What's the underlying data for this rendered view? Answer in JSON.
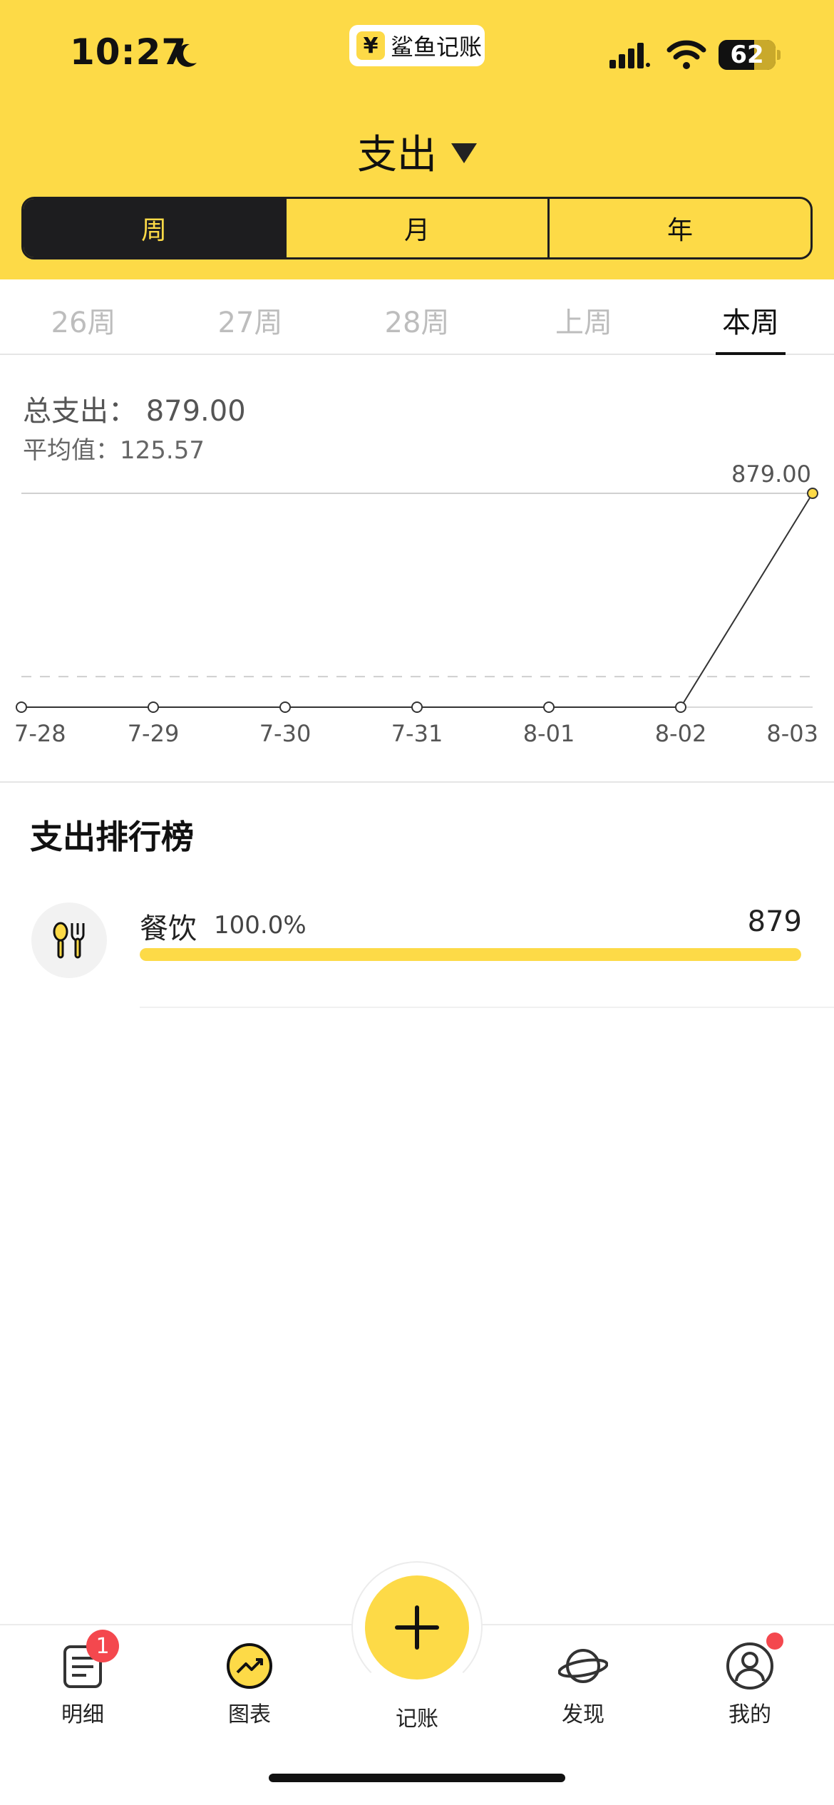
{
  "status_bar": {
    "time": "10:27",
    "app_name": "鲨鱼记账",
    "app_badge_glyph": "¥",
    "battery": "62"
  },
  "header": {
    "title": "支出",
    "segments": [
      {
        "label": "周",
        "active": true
      },
      {
        "label": "月",
        "active": false
      },
      {
        "label": "年",
        "active": false
      }
    ]
  },
  "week_tabs": [
    {
      "label": "26周",
      "active": false
    },
    {
      "label": "27周",
      "active": false
    },
    {
      "label": "28周",
      "active": false
    },
    {
      "label": "上周",
      "active": false
    },
    {
      "label": "本周",
      "active": true
    }
  ],
  "summary": {
    "total_text": "总支出：  879.00",
    "avg_text": "平均值：125.57"
  },
  "chart_data": {
    "type": "line",
    "x": [
      "7-28",
      "7-29",
      "7-30",
      "7-31",
      "8-01",
      "8-02",
      "8-03"
    ],
    "series": [
      {
        "values": [
          0,
          0,
          0,
          0,
          0,
          0,
          879
        ]
      }
    ],
    "max_label": "879.00",
    "average": 125.57,
    "ylim": [
      0,
      879
    ],
    "grid": false,
    "colors": {
      "line": "#333333",
      "highlight_point": "#FDDA47",
      "average_line": "#cfcfcf"
    }
  },
  "ranking": {
    "title": "支出排行榜",
    "items": [
      {
        "name": "餐饮",
        "percent": "100.0%",
        "amount": "879",
        "fraction": 1.0,
        "icon": "utensils-icon"
      }
    ]
  },
  "tabbar": {
    "items": [
      {
        "label": "明细",
        "icon": "list-icon",
        "badge": "1"
      },
      {
        "label": "图表",
        "icon": "chart-icon"
      },
      {
        "label": "发现",
        "icon": "planet-icon"
      },
      {
        "label": "我的",
        "icon": "user-icon"
      }
    ],
    "fab_label": "记账"
  },
  "colors": {
    "accent": "#FDDA47",
    "dark": "#1d1d1f",
    "badge": "#F4484E"
  }
}
